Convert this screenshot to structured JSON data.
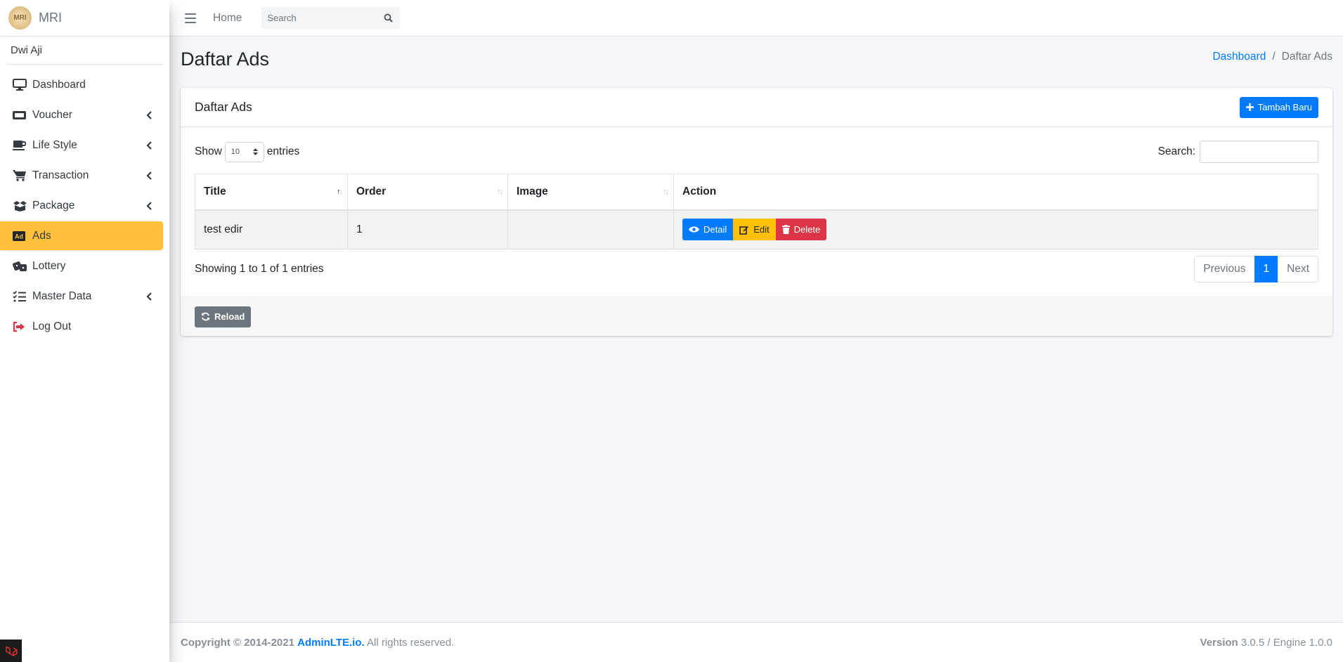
{
  "brand": {
    "name": "MRI",
    "logo_text": "MRI"
  },
  "user": {
    "name": "Dwi Aji"
  },
  "sidebar": {
    "items": [
      {
        "label": "Dashboard",
        "icon": "desktop-icon",
        "has_children": false,
        "active": false
      },
      {
        "label": "Voucher",
        "icon": "ticket-icon",
        "has_children": true,
        "active": false
      },
      {
        "label": "Life Style",
        "icon": "coffee-icon",
        "has_children": true,
        "active": false
      },
      {
        "label": "Transaction",
        "icon": "cart-icon",
        "has_children": true,
        "active": false
      },
      {
        "label": "Package",
        "icon": "box-open-icon",
        "has_children": true,
        "active": false
      },
      {
        "label": "Ads",
        "icon": "ad-icon",
        "has_children": false,
        "active": true
      },
      {
        "label": "Lottery",
        "icon": "dice-icon",
        "has_children": false,
        "active": false
      },
      {
        "label": "Master Data",
        "icon": "tasks-icon",
        "has_children": true,
        "active": false
      },
      {
        "label": "Log Out",
        "icon": "sign-out-icon",
        "has_children": false,
        "active": false
      }
    ]
  },
  "topnav": {
    "home_label": "Home",
    "search_placeholder": "Search"
  },
  "page": {
    "title": "Daftar Ads",
    "breadcrumb": {
      "parent": "Dashboard",
      "current": "Daftar Ads",
      "separator": "/"
    }
  },
  "card": {
    "title": "Daftar Ads",
    "add_button": "Tambah Baru",
    "reload_button": "Reload"
  },
  "datatable": {
    "show_label": "Show",
    "entries_label": "entries",
    "page_length": "10",
    "search_label": "Search:",
    "columns": [
      "Title",
      "Order",
      "Image",
      "Action"
    ],
    "rows": [
      {
        "title": "test edir",
        "order": "1",
        "image": ""
      }
    ],
    "actions": {
      "detail": "Detail",
      "edit": "Edit",
      "delete": "Delete"
    },
    "info": "Showing 1 to 1 of 1 entries",
    "pagination": {
      "previous": "Previous",
      "current": "1",
      "next": "Next"
    }
  },
  "footer": {
    "copyright": "Copyright © 2014-2021",
    "link": "AdminLTE.io.",
    "rights": "All rights reserved.",
    "version_label": "Version",
    "version_value": "3.0.5 / Engine 1.0.0"
  },
  "colors": {
    "primary": "#007bff",
    "warning": "#ffc107",
    "danger": "#dc3545",
    "active_nav": "#ffc13b",
    "secondary": "#6c757d"
  }
}
